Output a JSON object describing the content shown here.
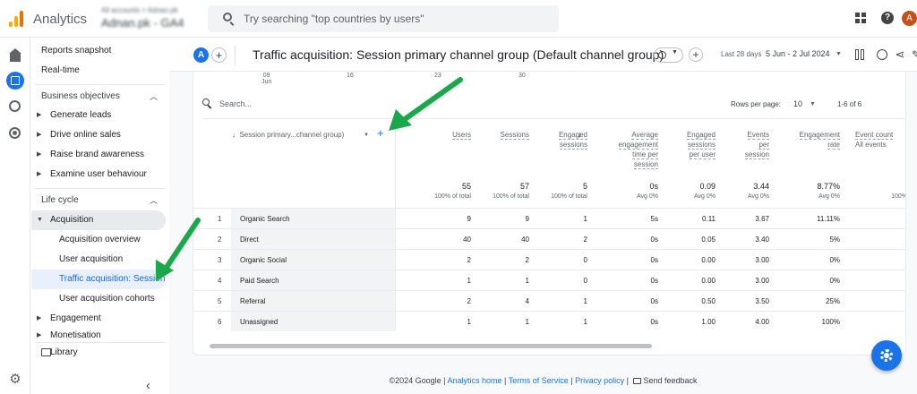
{
  "app": {
    "title": "Analytics",
    "account_line1": "All accounts > Adnan.pk",
    "account_line2": "Adnan.pk - GA4",
    "search_placeholder": "Try searching \"top countries by users\"",
    "avatar_letter": "A",
    "help_label": "?"
  },
  "sidebar": {
    "top_items": [
      "Reports snapshot",
      "Real-time"
    ],
    "business_section": "Business objectives",
    "business_items": [
      "Generate leads",
      "Drive online sales",
      "Raise brand awareness",
      "Examine user behaviour"
    ],
    "lifecycle_section": "Life cycle",
    "acquisition": "Acquisition",
    "acquisition_sub": [
      "Acquisition overview",
      "User acquisition",
      "Traffic acquisition: Session...",
      "User acquisition cohorts"
    ],
    "engagement": "Engagement",
    "monetisation": "Monetisation",
    "library": "Library"
  },
  "header": {
    "badge": "A",
    "title": "Traffic acquisition: Session primary channel group (Default channel group)",
    "date_label": "Last 28 days",
    "date_range": "5 Jun - 2 Jul 2024"
  },
  "chart_axis": {
    "ticks": [
      {
        "day": "09",
        "month": "Jun"
      },
      {
        "day": "16",
        "month": ""
      },
      {
        "day": "23",
        "month": ""
      },
      {
        "day": "30",
        "month": ""
      }
    ]
  },
  "table": {
    "search_placeholder": "Search...",
    "rows_per_page_label": "Rows per page:",
    "rows_per_page": "10",
    "pagination": "1-6 of 6",
    "dimension_header": "Session primary...channel group)",
    "columns": [
      {
        "label": [
          "Users"
        ],
        "total": "55",
        "sub": "100% of total"
      },
      {
        "label": [
          "Sessions"
        ],
        "total": "57",
        "sub": "100% of total"
      },
      {
        "label": [
          "Engaged",
          "sessions"
        ],
        "total": "5",
        "sub": "100% of total"
      },
      {
        "label": [
          "Average",
          "engagement",
          "time per",
          "session"
        ],
        "total": "0s",
        "sub": "Avg 0%"
      },
      {
        "label": [
          "Engaged",
          "sessions",
          "per user"
        ],
        "total": "0.09",
        "sub": "Avg 0%"
      },
      {
        "label": [
          "Events",
          "per",
          "session"
        ],
        "total": "3.44",
        "sub": "Avg 0%"
      },
      {
        "label": [
          "Engagement",
          "rate"
        ],
        "total": "8.77%",
        "sub": "Avg 0%"
      },
      {
        "label": [
          "Event count",
          "All events"
        ],
        "total": "",
        "sub": "100%"
      }
    ],
    "rows": [
      {
        "n": "1",
        "name": "Organic Search",
        "vals": [
          "9",
          "9",
          "1",
          "5s",
          "0.11",
          "3.67",
          "11.11%"
        ]
      },
      {
        "n": "2",
        "name": "Direct",
        "vals": [
          "40",
          "40",
          "2",
          "0s",
          "0.05",
          "3.40",
          "5%"
        ]
      },
      {
        "n": "3",
        "name": "Organic Social",
        "vals": [
          "2",
          "2",
          "0",
          "0s",
          "0.00",
          "3.00",
          "0%"
        ]
      },
      {
        "n": "4",
        "name": "Paid Search",
        "vals": [
          "1",
          "1",
          "0",
          "0s",
          "0.00",
          "3.00",
          "0%"
        ]
      },
      {
        "n": "5",
        "name": "Referral",
        "vals": [
          "2",
          "4",
          "1",
          "0s",
          "0.50",
          "3.50",
          "25%"
        ]
      },
      {
        "n": "6",
        "name": "Unassigned",
        "vals": [
          "1",
          "1",
          "1",
          "0s",
          "1.00",
          "4.00",
          "100%"
        ]
      }
    ]
  },
  "footer": {
    "copyright": "©2024 Google |",
    "links": [
      "Analytics home",
      "Terms of Service",
      "Privacy policy"
    ],
    "feedback": "Send feedback"
  },
  "colors": {
    "accent": "#1a73e8",
    "annotation": "#1aa84a"
  }
}
